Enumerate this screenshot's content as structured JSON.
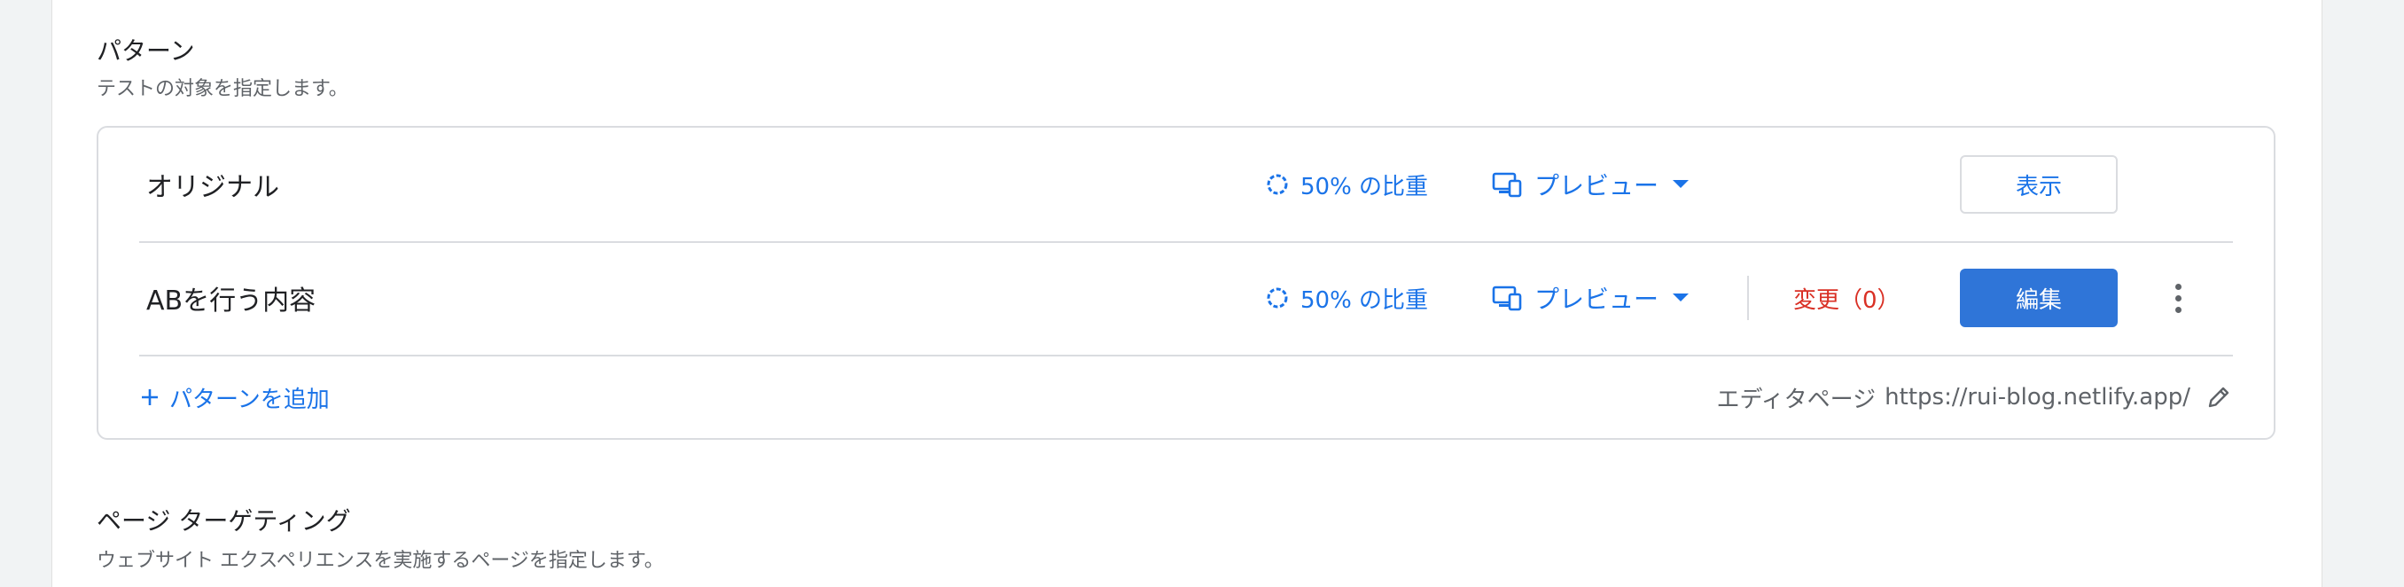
{
  "section_pattern": {
    "title": "パターン",
    "subtitle": "テストの対象を指定します。"
  },
  "patterns": [
    {
      "name": "オリジナル",
      "weight": "50% の比重",
      "preview": "プレビュー",
      "action": "表示"
    },
    {
      "name": "ABを行う内容",
      "weight": "50% の比重",
      "preview": "プレビュー",
      "changes": "変更（0）",
      "action": "編集"
    }
  ],
  "footer": {
    "add_pattern": "パターンを追加",
    "editor_label": "エディタページ",
    "editor_url": "https://rui-blog.netlify.app/"
  },
  "section_targeting": {
    "title": "ページ ターゲティング",
    "subtitle": "ウェブサイト エクスペリエンスを実施するページを指定します。"
  },
  "colors": {
    "accent": "#1a73e8",
    "primary_button": "#2f75d8",
    "changes": "#d93025",
    "border": "#dadce0"
  },
  "icons": [
    "weight-circle-icon",
    "device-preview-icon",
    "caret-down-icon",
    "plus-icon",
    "pencil-icon",
    "more-vert-icon"
  ]
}
